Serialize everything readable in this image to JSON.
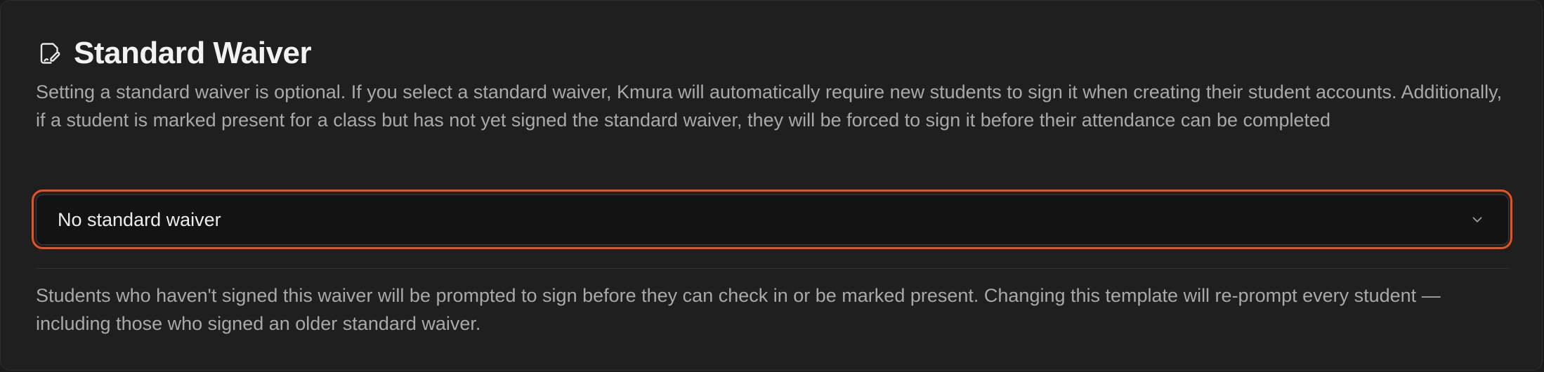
{
  "section": {
    "icon": "file-signature-icon",
    "title": "Standard Waiver",
    "description": "Setting a standard waiver is optional. If you select a standard waiver, Kmura will automatically require new students to sign it when creating their student accounts. Additionally, if a student is marked present for a class but has not yet signed the standard waiver, they will be forced to sign it before their attendance can be completed"
  },
  "waiver_select": {
    "selected_value": "No standard waiver",
    "icon": "chevron-down-icon",
    "focused": true,
    "focus_color": "#e8521f"
  },
  "helper_text": "Students who haven't signed this waiver will be prompted to sign before they can check in or be marked present. Changing this template will re-prompt every student — including those who signed an older standard waiver."
}
